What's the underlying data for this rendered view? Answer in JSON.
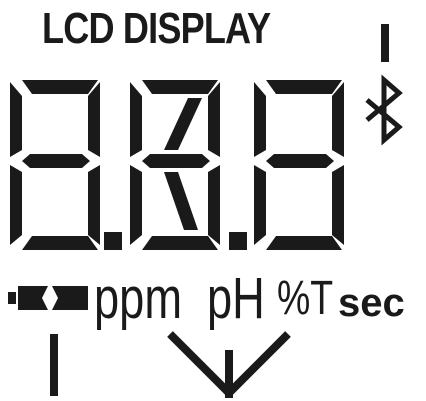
{
  "title": "LCD DISPLAY",
  "digits": [
    "8",
    "8",
    "8"
  ],
  "units": {
    "ppm": "ppm",
    "ph": "pH",
    "pct_t": "%T",
    "sec": "sec"
  },
  "icons": {
    "bluetooth": "bluetooth-icon",
    "battery": "battery-icon"
  },
  "colors": {
    "ink": "#1a1a1a",
    "background": "#ffffff"
  }
}
